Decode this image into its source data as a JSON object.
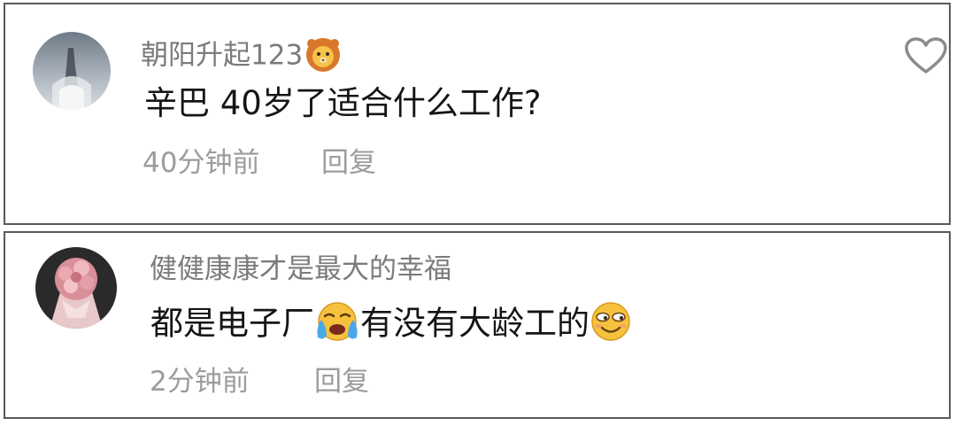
{
  "comments": [
    {
      "username": "朝阳升起123",
      "username_badge": "lion-emoji",
      "text": "辛巴 40岁了适合什么工作?",
      "time": "40分钟前",
      "reply_label": "回复",
      "like_icon": "heart-outline-icon"
    },
    {
      "username": "健健康康才是最大的幸福",
      "text_part1": "都是电子厂",
      "text_emoji1": "crying-face-emoji",
      "text_part2": "有没有大龄工的",
      "text_emoji2": "smirking-face-emoji",
      "time": "2分钟前",
      "reply_label": "回复"
    }
  ],
  "colors": {
    "username": "#7b7b7b",
    "comment_text": "#151515",
    "meta_text": "#9c9c9c",
    "card_border": "#5a5a5a"
  }
}
